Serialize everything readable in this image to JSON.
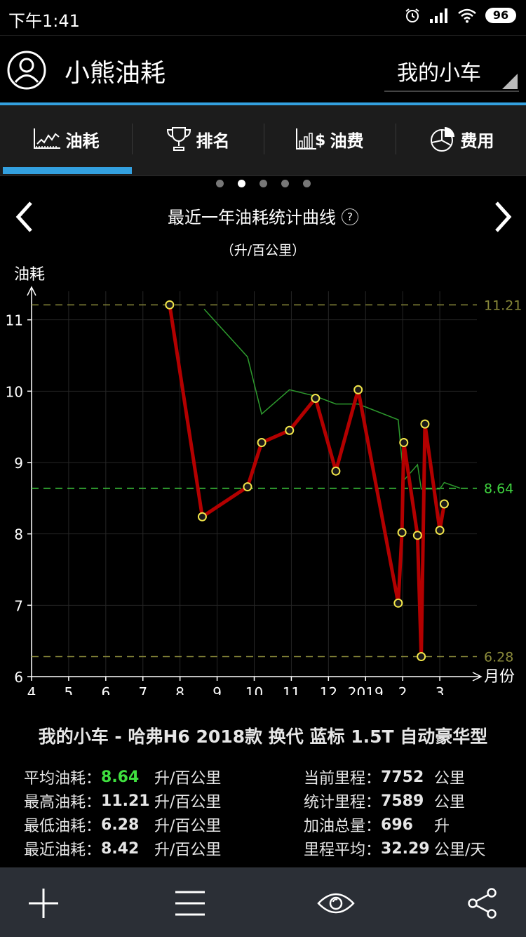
{
  "status": {
    "time": "下午1:41",
    "battery": "96"
  },
  "app": {
    "title": "小熊油耗",
    "car_selector": "我的小车"
  },
  "tabs": [
    {
      "label": "油耗",
      "icon": "line-chart-icon"
    },
    {
      "label": "排名",
      "icon": "trophy-icon"
    },
    {
      "label": "油费",
      "icon": "bar-dollar-icon"
    },
    {
      "label": "费用",
      "icon": "pie-chart-icon"
    }
  ],
  "active_tab": "油耗",
  "pager": {
    "count": 5,
    "active": 2
  },
  "chart_header": {
    "title": "最近一年油耗统计曲线",
    "help": "?",
    "unit": "（升/百公里）"
  },
  "chart_data": {
    "type": "line",
    "title": "最近一年油耗统计曲线",
    "ylabel": "油耗",
    "xlabel": "月份",
    "ylim": [
      6,
      11.4
    ],
    "xlim": [
      4,
      3.2
    ],
    "y_ticks": [
      "6",
      "7",
      "8",
      "9",
      "10",
      "11"
    ],
    "x_ticks": [
      "4",
      "5",
      "6",
      "7",
      "8",
      "9",
      "10",
      "11",
      "12",
      "2019",
      "2",
      "3"
    ],
    "x_tick_values": [
      4,
      5,
      6,
      7,
      8,
      9,
      10,
      11,
      12,
      13,
      14,
      15
    ],
    "reference_lines": [
      {
        "label": "11.21",
        "value": 11.21,
        "color": "#8a8a3a"
      },
      {
        "label": "8.64",
        "value": 8.64,
        "color": "#3fd33f"
      },
      {
        "label": "6.28",
        "value": 6.28,
        "color": "#8a8a3a"
      }
    ],
    "series": [
      {
        "color": "#b30000",
        "x": [
          7.72,
          8.6,
          9.82,
          10.2,
          10.95,
          11.65,
          12.2,
          12.8,
          13.88,
          13.98,
          14.03,
          14.4,
          14.5,
          14.6,
          15.0,
          15.12
        ],
        "y": [
          11.21,
          8.24,
          8.66,
          9.28,
          9.45,
          9.9,
          8.88,
          10.02,
          7.03,
          8.02,
          9.28,
          7.98,
          6.28,
          9.54,
          8.05,
          8.42
        ]
      },
      {
        "color": "#2d9a2d",
        "x": [
          8.65,
          9.82,
          10.2,
          10.95,
          11.65,
          12.2,
          12.8,
          13.88,
          14.03,
          14.4,
          14.5,
          14.6,
          15.0,
          15.12,
          15.55
        ],
        "y": [
          11.15,
          10.48,
          9.68,
          10.02,
          9.93,
          9.82,
          9.82,
          9.6,
          8.75,
          8.97,
          8.63,
          8.63,
          8.63,
          8.72,
          8.64
        ]
      }
    ]
  },
  "car_model": "我的小车 - 哈弗H6 2018款 换代 蓝标 1.5T 自动豪华型",
  "stats_left": [
    {
      "label": "平均油耗：",
      "value": "8.64",
      "unit": "升/百公里",
      "value_color": "#3fe03f"
    },
    {
      "label": "最高油耗：",
      "value": "11.21",
      "unit": "升/百公里",
      "value_color": "#e6e6e6"
    },
    {
      "label": "最低油耗：",
      "value": "6.28",
      "unit": "升/百公里",
      "value_color": "#e6e6e6"
    },
    {
      "label": "最近油耗：",
      "value": "8.42",
      "unit": "升/百公里",
      "value_color": "#e6e6e6"
    }
  ],
  "stats_right": [
    {
      "label": "当前里程：",
      "value": "7752",
      "unit": "公里"
    },
    {
      "label": "统计里程：",
      "value": "7589",
      "unit": "公里"
    },
    {
      "label": "加油总量：",
      "value": "696",
      "unit": "升"
    },
    {
      "label": "里程平均：",
      "value": "32.29",
      "unit": "公里/天"
    }
  ],
  "bottom_bar": [
    "add-icon",
    "menu-icon",
    "eye-icon",
    "share-icon"
  ]
}
